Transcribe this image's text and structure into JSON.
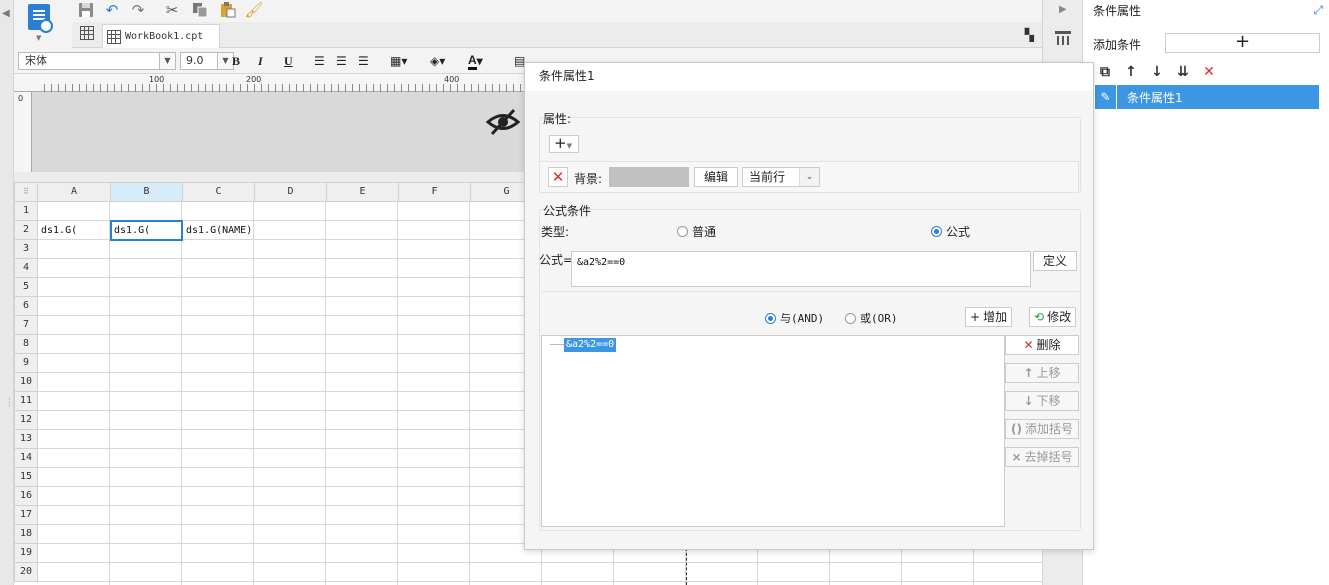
{
  "tab": {
    "filename": "WorkBook1.cpt"
  },
  "format": {
    "font": "宋体",
    "size": "9.0"
  },
  "ruler": {
    "labels": [
      "0",
      "100",
      "200",
      "400"
    ]
  },
  "sheet": {
    "columns": [
      "A",
      "B",
      "C",
      "D",
      "E",
      "F",
      "G"
    ],
    "rows": [
      "1",
      "2",
      "3",
      "4",
      "5",
      "6",
      "7",
      "8",
      "9",
      "10",
      "11",
      "12",
      "13",
      "14",
      "15",
      "16",
      "17",
      "18",
      "19",
      "20"
    ],
    "cells": {
      "A2": "ds1.G(",
      "B2": "ds1.G(",
      "C2": "ds1.G(NAME)"
    },
    "selected_cell": "B2"
  },
  "condition_panel": {
    "title": "条件属性",
    "add_label": "添加条件",
    "add_button": "+",
    "items": [
      "条件属性1"
    ]
  },
  "dialog": {
    "title": "条件属性1",
    "properties_label": "属性:",
    "background_label": "背景:",
    "background_color": "#c0c0c0",
    "edit_button": "编辑",
    "scope_select": "当前行",
    "formula_section_label": "公式条件",
    "type_label": "类型:",
    "type_options": [
      "普通",
      "公式"
    ],
    "type_selected": "公式",
    "formula_label": "公式=",
    "formula_value": "&a2%2==0",
    "define_button": "定义",
    "logic_options": [
      "与(AND)",
      "或(OR)"
    ],
    "logic_selected": "与(AND)",
    "add_button": "增加",
    "modify_button": "修改",
    "conditions": [
      "&a2%2==0"
    ],
    "side_buttons": {
      "delete": "删除",
      "move_up": "上移",
      "move_down": "下移",
      "add_bracket": "添加括号",
      "remove_bracket": "去掉括号"
    }
  },
  "colors": {
    "accent": "#3d96e3",
    "danger": "#d93030"
  }
}
